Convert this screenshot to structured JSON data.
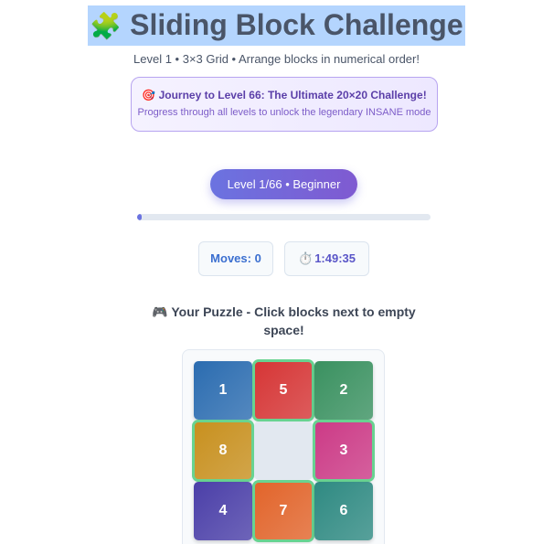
{
  "header": {
    "title_emoji": "🧩",
    "title": "Sliding Block Challenge",
    "subtitle": "Level 1 • 3×3 Grid • Arrange blocks in numerical order!"
  },
  "banner": {
    "title": "🎯 Journey to Level 66: The Ultimate 20×20 Challenge!",
    "subtitle": "Progress through all levels to unlock the legendary INSANE mode"
  },
  "level": {
    "label": "Level 1/66 • Beginner",
    "progress_percent": 1.5
  },
  "stats": {
    "moves_label": "Moves: 0",
    "timer_icon": "⏱️",
    "timer": "1:49:35"
  },
  "puzzle": {
    "heading": "🎮 Your Puzzle - Click blocks next to empty space!",
    "tiles": [
      {
        "label": "1",
        "color": "#2b6cb0",
        "movable": false
      },
      {
        "label": "5",
        "color": "#d63535",
        "movable": true
      },
      {
        "label": "2",
        "color": "#3a9160",
        "movable": false
      },
      {
        "label": "8",
        "color": "#c8901e",
        "movable": true
      },
      {
        "label": "",
        "color": "#e2e8f0",
        "movable": false,
        "empty": true
      },
      {
        "label": "3",
        "color": "#cc3a86",
        "movable": true
      },
      {
        "label": "4",
        "color": "#4b3fa8",
        "movable": false
      },
      {
        "label": "7",
        "color": "#e2642a",
        "movable": true
      },
      {
        "label": "6",
        "color": "#2f8a82",
        "movable": false
      }
    ]
  }
}
